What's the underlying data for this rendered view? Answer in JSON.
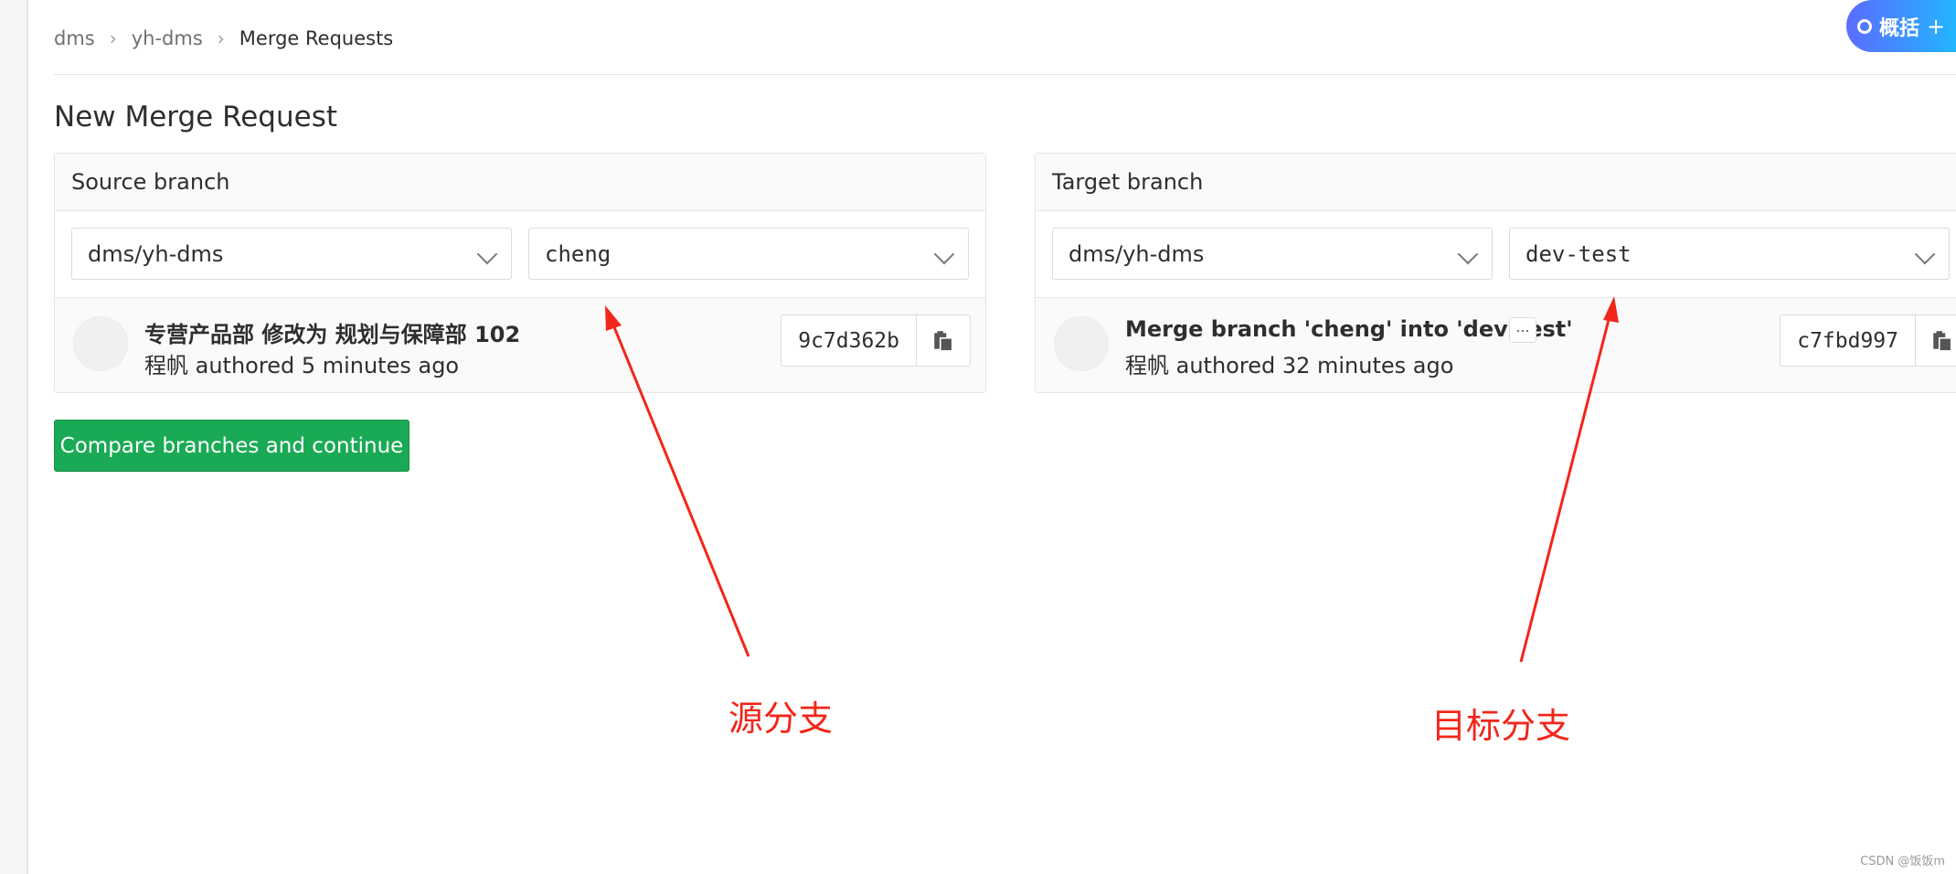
{
  "breadcrumb": {
    "items": [
      "dms",
      "yh-dms"
    ],
    "current": "Merge Requests"
  },
  "page_title": "New Merge Request",
  "source": {
    "header": "Source branch",
    "project": "dms/yh-dms",
    "branch": "cheng",
    "commit": {
      "title": "专营产品部 修改为 规划与保障部 102",
      "meta": "程帆 authored 5 minutes ago",
      "sha": "9c7d362b"
    }
  },
  "target": {
    "header": "Target branch",
    "project": "dms/yh-dms",
    "branch": "dev-test",
    "commit": {
      "title": "Merge branch 'cheng' into 'dev-test'",
      "ellipsis": "...",
      "meta": "程帆 authored 32 minutes ago",
      "sha": "c7fbd997"
    }
  },
  "compare_button": "Compare branches and continue",
  "annotations": {
    "source": "源分支",
    "target": "目标分支",
    "color": "#f2261a"
  },
  "summary_button": {
    "label": "概括",
    "plus": "+"
  },
  "watermark": "CSDN @饭饭m",
  "colors": {
    "primary_green": "#1aaa55"
  }
}
